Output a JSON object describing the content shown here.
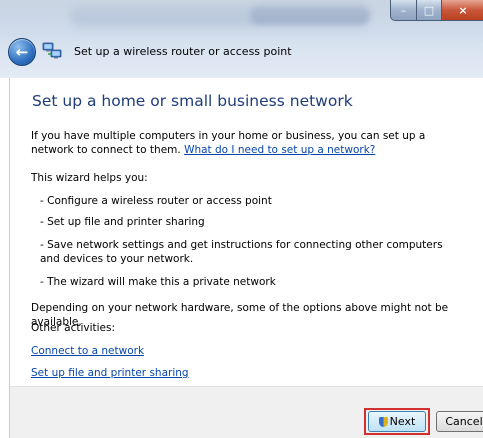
{
  "window": {
    "title": "Set up a wireless router or access point",
    "controls": {
      "minimize": "–",
      "maximize": "□",
      "close": "×"
    }
  },
  "content": {
    "heading": "Set up a home or small business network",
    "intro": "If you have multiple computers in your home or business, you can set up a network to connect to them.",
    "intro_link": "What do I need to set up a network?",
    "helps_label": "This wizard helps you:",
    "helps_items": [
      "- Configure a wireless router or access point",
      "- Set up file and printer sharing",
      "- Save network settings and get instructions for connecting other computers and devices to your network.",
      "- The wizard will make this a private network"
    ],
    "note": "Depending on your network hardware, some of the options above might not be available.",
    "other_label": "Other activities:",
    "links": [
      "Connect to a network",
      "Set up file and printer sharing"
    ]
  },
  "footer": {
    "next_label": "Next",
    "cancel_label": "Cancel"
  },
  "icons": {
    "back": "back-arrow-icon",
    "network": "network-icon",
    "shield": "uac-shield-icon"
  },
  "colors": {
    "heading": "#1e3d7a",
    "link": "#0645ad",
    "highlight": "#d32f2f"
  }
}
